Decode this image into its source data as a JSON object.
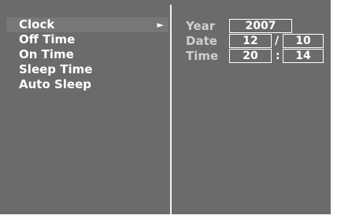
{
  "menu": {
    "items": [
      {
        "label": "Clock",
        "selected": true,
        "icon": "triangle-right-icon"
      },
      {
        "label": "Off Time",
        "selected": false
      },
      {
        "label": "On Time",
        "selected": false
      },
      {
        "label": "Sleep Time",
        "selected": false
      },
      {
        "label": "Auto Sleep",
        "selected": false
      }
    ],
    "selected_arrow": "►"
  },
  "clock": {
    "year_label": "Year",
    "year_value": "2007",
    "date_label": "Date",
    "date_month": "12",
    "date_sep": "/",
    "date_day": "10",
    "time_label": "Time",
    "time_hour": "20",
    "time_sep": ":",
    "time_minute": "14"
  },
  "colors": {
    "background": "#6b6b6b",
    "selected_row": "#777777",
    "label": "#cfcfcf",
    "text": "#ffffff"
  }
}
